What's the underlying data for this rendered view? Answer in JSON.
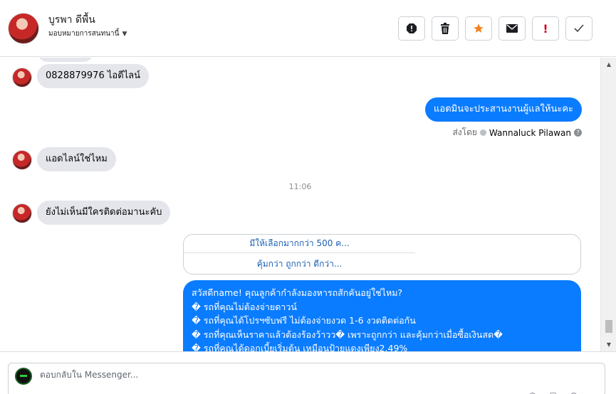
{
  "header": {
    "contact_name": "บูรพา ดีพื้น",
    "assign_label": "มอบหมายการสนทนานี้",
    "actions": [
      {
        "name": "spam-icon",
        "glyph": "!"
      },
      {
        "name": "trash-icon",
        "glyph": "🗑"
      },
      {
        "name": "star-icon",
        "glyph": "★"
      },
      {
        "name": "mail-icon",
        "glyph": "✉"
      },
      {
        "name": "important-icon",
        "glyph": "!"
      },
      {
        "name": "check-icon",
        "glyph": "✓"
      }
    ]
  },
  "messages": {
    "m1": "0828879976 ไอดีไลน์",
    "m2_out": "แอดมินจะประสานงานผู้แลให้นะคะ",
    "sent_by_label": "ส่งโดย",
    "sent_by_name": "Wannaluck Pilawan",
    "m3": "แอดไลน์ใช่ไหม",
    "time": "11:06",
    "m4": "ยังไม่เห็นมีใครติดต่อมานะคับ",
    "card_button_1": "มีให้เลือกมากกว่า 500 ค...",
    "card_button_2": "คุ้มกว่า ถูกกว่า ดีกว่า...",
    "big_lines": [
      "สวัสดีname! คุณลูกค้ากำลังมองหารถสักคันอยู่ใช่ไหม?",
      "� รถที่คุณไม่ต้องจ่ายดาวน์",
      "� รถที่คุณได้โปรฯซับฟรี ไม่ต้องจ่ายงวด 1-6 งวดติดต่อกัน",
      "� รถที่คุณเห็นราคาแล้วต้องร้องว้าวว� เพราะถูกกว่า และคุ้มกว่าเมื่อซื้อเงินสด�",
      "� รถที่คุณได้ดอกเบี้ยเริ่มต้น เหมือนป้ายแดงเพียง2.49%"
    ]
  },
  "composer": {
    "placeholder": "ตอบกลับใน Messenger..."
  },
  "colors": {
    "accent": "#0a7cff",
    "star": "#f5821f",
    "important": "#d0021b"
  }
}
